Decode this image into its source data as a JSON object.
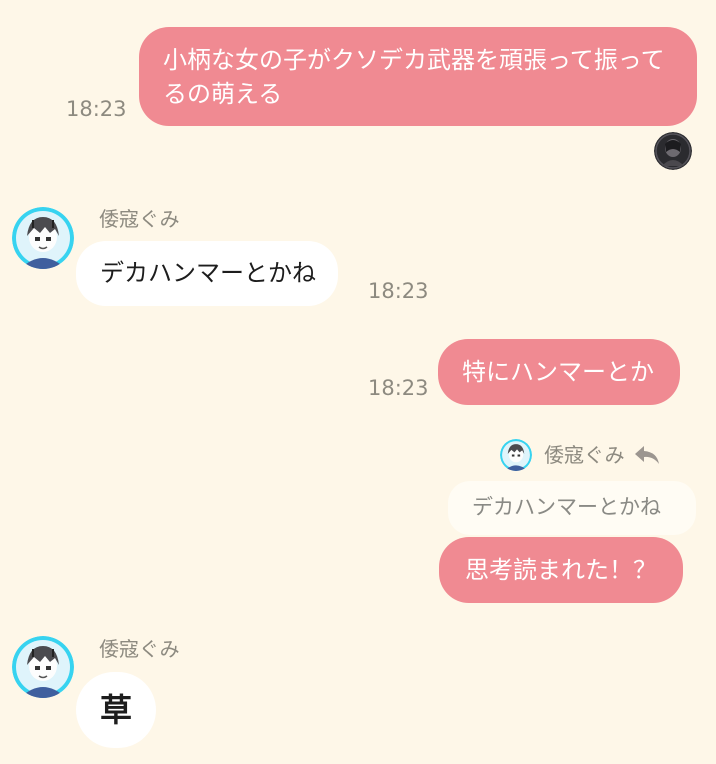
{
  "messages": [
    {
      "text": "小柄な女の子がクソデカ武器を頑張って振ってるの萌える",
      "time": "18:23"
    },
    {
      "sender": "倭寇ぐみ",
      "text": "デカハンマーとかね",
      "time": "18:23"
    },
    {
      "text": "特にハンマーとか",
      "time": "18:23"
    },
    {
      "reply_to": {
        "sender": "倭寇ぐみ",
        "text": "デカハンマーとかね"
      },
      "text": "思考読まれた！？"
    },
    {
      "sender": "倭寇ぐみ",
      "text": "草"
    }
  ],
  "icons": {
    "avatar_self": "dark-avatar-icon",
    "avatar_other": "anime-character-avatar-icon",
    "reply": "reply-arrow-icon"
  },
  "colors": {
    "background": "#fef7e8",
    "outgoing_bubble": "#f08a92",
    "incoming_bubble": "#ffffff",
    "meta_text": "#8d8a80"
  }
}
